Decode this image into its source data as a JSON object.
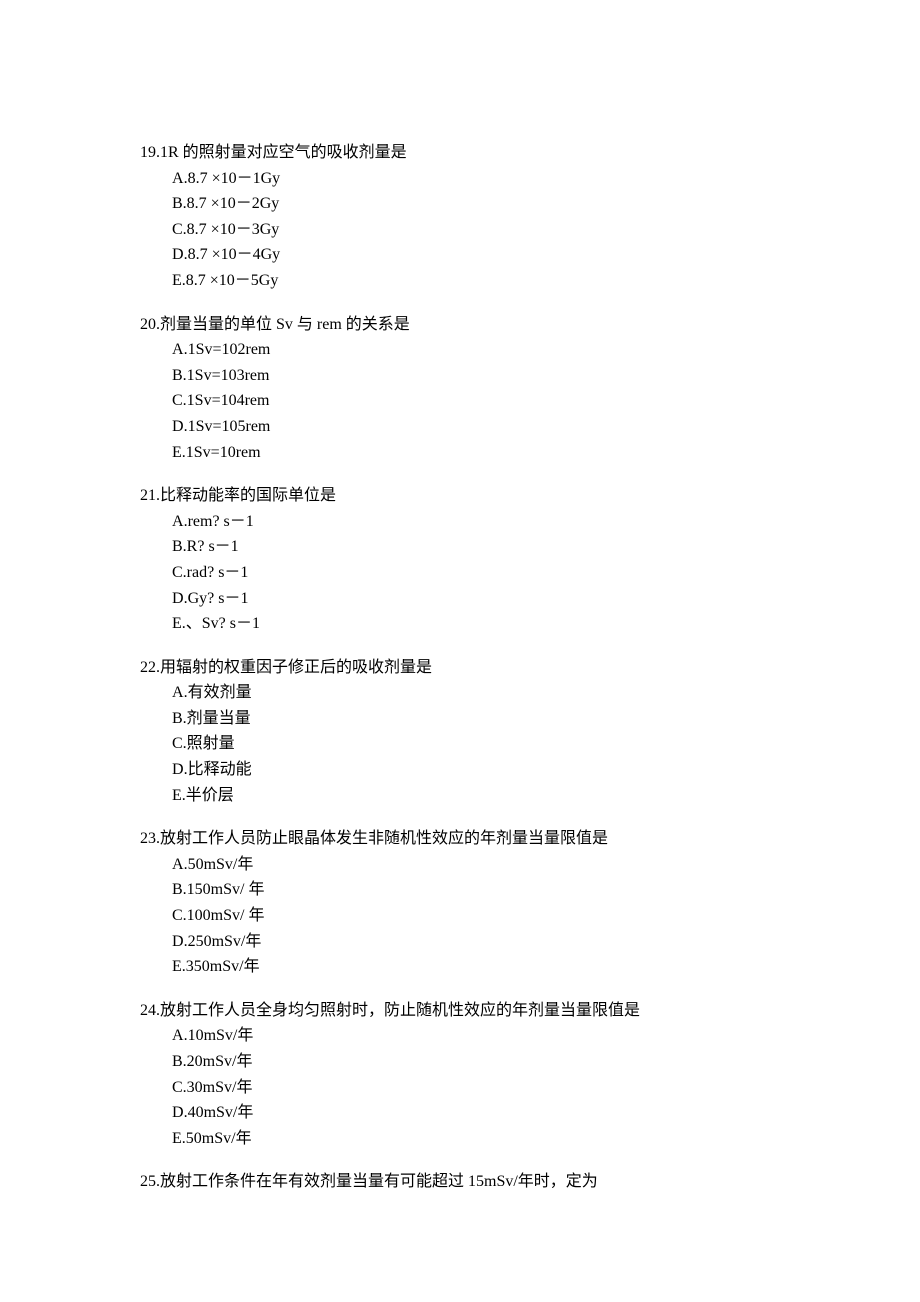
{
  "questions": [
    {
      "number": "19",
      "stem": "1R 的照射量对应空气的吸收剂量是",
      "options": [
        {
          "label": "A",
          "text": "8.7 ×10－1Gy"
        },
        {
          "label": "B",
          "text": "8.7 ×10－2Gy"
        },
        {
          "label": "C",
          "text": "8.7 ×10－3Gy"
        },
        {
          "label": "D",
          "text": "8.7 ×10－4Gy"
        },
        {
          "label": "E",
          "text": "8.7 ×10－5Gy"
        }
      ]
    },
    {
      "number": "20",
      "stem": "剂量当量的单位 Sv 与 rem 的关系是",
      "options": [
        {
          "label": "A",
          "text": "1Sv=102rem"
        },
        {
          "label": "B",
          "text": "1Sv=103rem"
        },
        {
          "label": "C",
          "text": "1Sv=104rem"
        },
        {
          "label": "D",
          "text": "1Sv=105rem"
        },
        {
          "label": "E",
          "text": "1Sv=10rem"
        }
      ]
    },
    {
      "number": "21",
      "stem": "比释动能率的国际单位是",
      "options": [
        {
          "label": "A",
          "text": "rem?  s－1"
        },
        {
          "label": "B",
          "text": "R? s－1"
        },
        {
          "label": "C",
          "text": "rad? s－1"
        },
        {
          "label": "D",
          "text": "Gy? s－1"
        },
        {
          "label": "E",
          "text": "、Sv? s－1"
        }
      ]
    },
    {
      "number": "22",
      "stem": "用辐射的权重因子修正后的吸收剂量是",
      "options": [
        {
          "label": "A",
          "text": "有效剂量"
        },
        {
          "label": "B",
          "text": "剂量当量"
        },
        {
          "label": "C",
          "text": "照射量"
        },
        {
          "label": "D",
          "text": "比释动能"
        },
        {
          "label": "E",
          "text": "半价层"
        }
      ]
    },
    {
      "number": "23",
      "stem": "放射工作人员防止眼晶体发生非随机性效应的年剂量当量限值是",
      "options": [
        {
          "label": "A",
          "text": "50mSv/年"
        },
        {
          "label": "B",
          "text": "150mSv/ 年"
        },
        {
          "label": "C",
          "text": "100mSv/ 年"
        },
        {
          "label": "D",
          "text": "250mSv/年"
        },
        {
          "label": "E",
          "text": "350mSv/年"
        }
      ]
    },
    {
      "number": "24",
      "stem": "放射工作人员全身均匀照射时，防止随机性效应的年剂量当量限值是",
      "options": [
        {
          "label": "A",
          "text": "10mSv/年"
        },
        {
          "label": "B",
          "text": "20mSv/年"
        },
        {
          "label": "C",
          "text": "30mSv/年"
        },
        {
          "label": "D",
          "text": "40mSv/年"
        },
        {
          "label": "E",
          "text": "50mSv/年"
        }
      ]
    },
    {
      "number": "25",
      "stem": "放射工作条件在年有效剂量当量有可能超过 15mSv/年时，定为",
      "options": []
    }
  ]
}
